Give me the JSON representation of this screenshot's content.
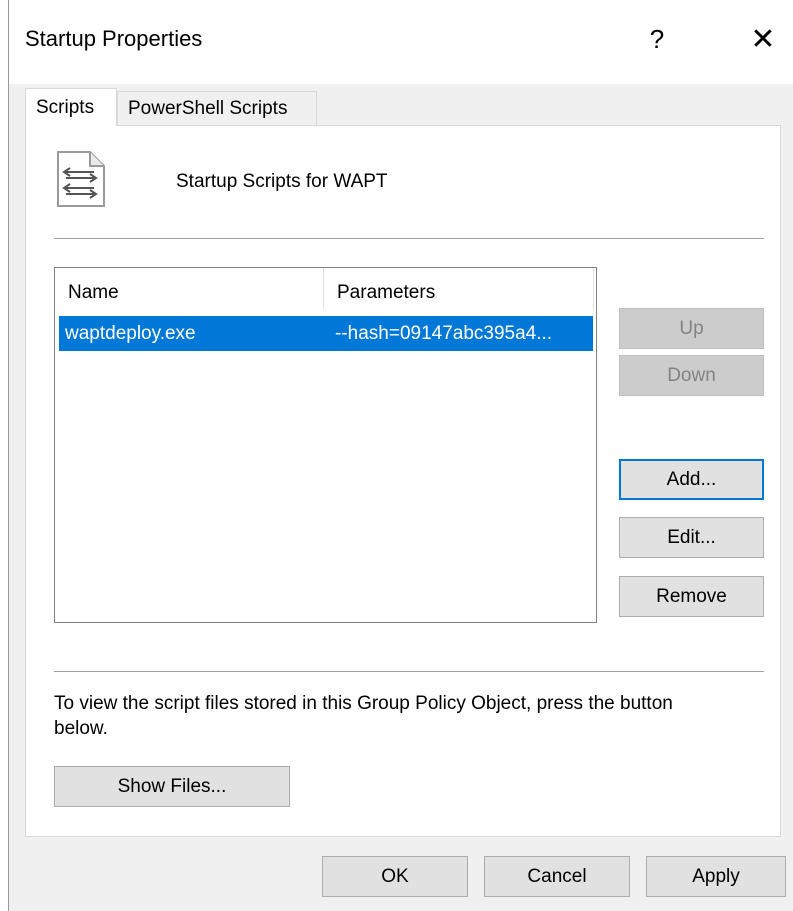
{
  "window": {
    "title": "Startup Properties",
    "help_label": "?",
    "close_label": "✕"
  },
  "tabs": [
    {
      "label": "Scripts",
      "active": true
    },
    {
      "label": "PowerShell Scripts",
      "active": false
    }
  ],
  "panel": {
    "heading": "Startup Scripts for WAPT",
    "icon": "script-file-icon"
  },
  "list": {
    "columns": [
      "Name",
      "Parameters"
    ],
    "rows": [
      {
        "name": "waptdeploy.exe",
        "parameters": "--hash=09147abc395a4..."
      }
    ]
  },
  "buttons": {
    "up": "Up",
    "down": "Down",
    "add": "Add...",
    "edit": "Edit...",
    "remove": "Remove",
    "show_files": "Show Files...",
    "ok": "OK",
    "cancel": "Cancel",
    "apply": "Apply"
  },
  "info_text": "To view the script files stored in this Group Policy Object, press the button below.",
  "colors": {
    "selection": "#0078d7",
    "dialog_bg": "#f0f0f0"
  }
}
